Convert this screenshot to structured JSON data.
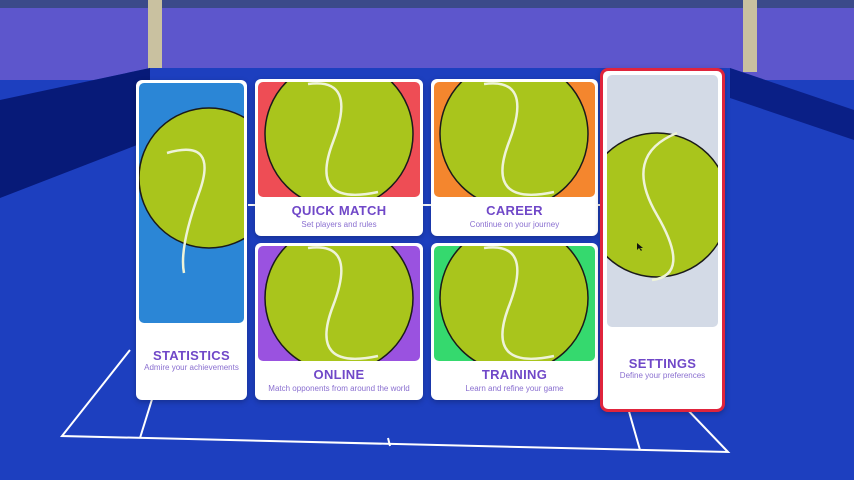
{
  "menu": {
    "cards": {
      "statistics": {
        "title": "STATISTICS",
        "subtitle": "Admire your achievements",
        "color": "#2b86d6"
      },
      "quick_match": {
        "title": "QUICK MATCH",
        "subtitle": "Set players and rules",
        "color": "#ee4d55"
      },
      "career": {
        "title": "CAREER",
        "subtitle": "Continue on your journey",
        "color": "#f4862e"
      },
      "online": {
        "title": "ONLINE",
        "subtitle": "Match opponents from around the world",
        "color": "#9a52e0"
      },
      "training": {
        "title": "TRAINING",
        "subtitle": "Learn and refine your game",
        "color": "#35d96e"
      },
      "settings": {
        "title": "SETTINGS",
        "subtitle": "Define your preferences",
        "color": "#d3dae6",
        "selected": true
      }
    }
  },
  "icons": {
    "card_art": "tennis-ball-icon",
    "cursor": "mouse-cursor-icon"
  },
  "colors": {
    "court": "#1d3fbf",
    "sky": "#5f58cc",
    "title_text": "#7048c8",
    "selection_border": "#e0243c"
  }
}
